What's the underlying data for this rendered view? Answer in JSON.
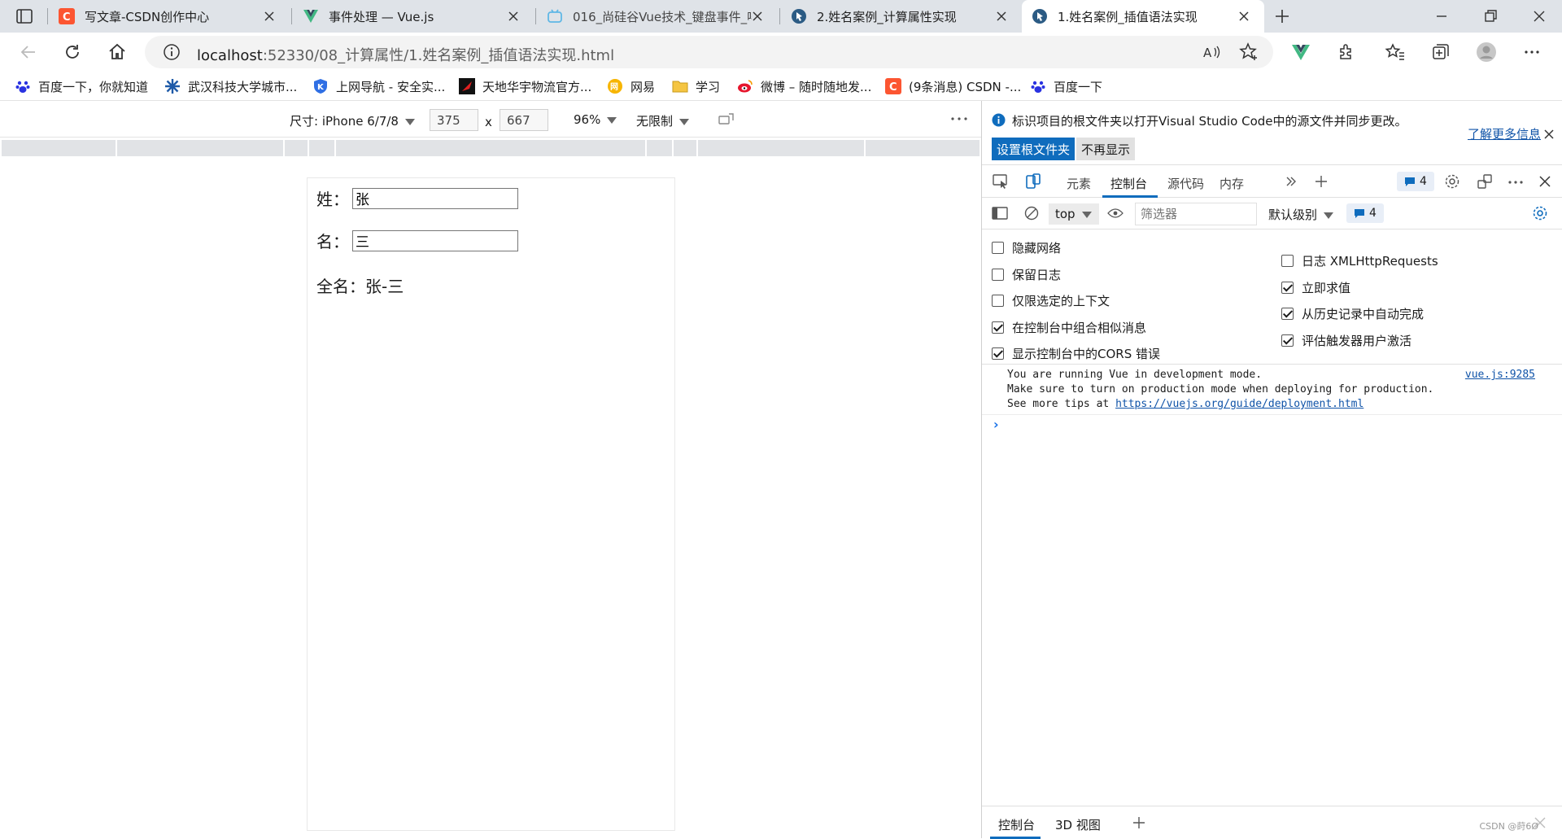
{
  "tabs": [
    {
      "title": "写文章-CSDN创作中心",
      "favicon": "csdn-icon"
    },
    {
      "title": "事件处理 — Vue.js",
      "favicon": "vue-icon"
    },
    {
      "title": "016_尚硅谷Vue技术_键盘事件_哔",
      "favicon": "bilibili-icon"
    },
    {
      "title": "2.姓名案例_计算属性实现",
      "favicon": "vscode-live-icon"
    },
    {
      "title": "1.姓名案例_插值语法实现",
      "favicon": "vscode-live-icon"
    }
  ],
  "address": {
    "host": "localhost",
    "rest": ":52330/08_计算属性/1.姓名案例_插值语法实现.html"
  },
  "bookmarks": [
    {
      "label": "百度一下，你就知道",
      "icon": "baidu-icon"
    },
    {
      "label": "武汉科技大学城市...",
      "icon": "snowflake-icon"
    },
    {
      "label": "上网导航 - 安全实...",
      "icon": "shield-k-icon"
    },
    {
      "label": "天地华宇物流官方...",
      "icon": "logistics-icon"
    },
    {
      "label": "网易",
      "icon": "netease-icon"
    },
    {
      "label": "学习",
      "icon": "folder-icon"
    },
    {
      "label": "微博 – 随时随地发...",
      "icon": "weibo-icon"
    },
    {
      "label": "(9条消息) CSDN -...",
      "icon": "csdn-icon"
    },
    {
      "label": "百度一下",
      "icon": "baidu-icon"
    }
  ],
  "device_toolbar": {
    "dimensions_label": "尺寸: iPhone 6/7/8",
    "width": "375",
    "times": "x",
    "height": "667",
    "zoom": "96%",
    "throttle": "无限制"
  },
  "page": {
    "last_label": "姓：",
    "last_value": "张",
    "first_label": "名：",
    "first_value": "三",
    "full_label": "全名：",
    "full_value": "张-三"
  },
  "devtools": {
    "info_text": "标识项目的根文件夹以打开Visual Studio Code中的源文件并同步更改。",
    "learn_more": "了解更多信息",
    "set_root_button": "设置根文件夹",
    "dont_show_button": "不再显示",
    "tabs": [
      "元素",
      "控制台",
      "源代码",
      "内存"
    ],
    "active_tab": "控制台",
    "issues_count": "4",
    "context": "top",
    "filter_placeholder": "筛选器",
    "level": "默认级别",
    "level_issues": "4",
    "settings_left": [
      {
        "label": "隐藏网络",
        "checked": false
      },
      {
        "label": "保留日志",
        "checked": false
      },
      {
        "label": "仅限选定的上下文",
        "checked": false
      },
      {
        "label": "在控制台中组合相似消息",
        "checked": true
      },
      {
        "label": "显示控制台中的CORS 错误",
        "checked": true
      }
    ],
    "settings_right": [
      {
        "label": "日志 XMLHttpRequests",
        "checked": false
      },
      {
        "label": "立即求值",
        "checked": true
      },
      {
        "label": "从历史记录中自动完成",
        "checked": true
      },
      {
        "label": "评估触发器用户激活",
        "checked": true
      }
    ],
    "console_lines": [
      "You are running Vue in development mode.",
      "Make sure to turn on production mode when deploying for production.",
      "See more tips at "
    ],
    "console_link": "https://vuejs.org/guide/deployment.html",
    "console_source": "vue.js:9285",
    "drawer_tabs": [
      "控制台",
      "3D 视图"
    ],
    "watermark": "CSDN @莳6Ø"
  },
  "colors": {
    "accent": "#0f6cbd",
    "tab_strip": "#dfe3e8",
    "vue_green": "#41b883",
    "csdn_red": "#fc5531"
  }
}
